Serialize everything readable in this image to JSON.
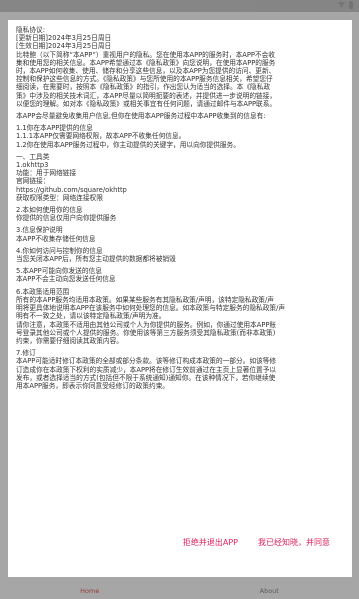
{
  "privacy": {
    "lines": [
      "隐私协议:",
      "[更新日期]2024年3月25日周日",
      "[生效日期]2024年3月25日周日",
      "  比特鲍（以下简称“本APP”）重视用户的隐私。您在使用本APP的服务时，本APP不会收",
      "集和使用您的相关信息。本APP希望通过本《隐私政策》向您说明，在使用本APP的服务",
      "时，本APP如何收集、使用、储存和分享这些信息，以及本APP为您提供的访问、更新、",
      "控制和保护这些信息的方式。《隐私政策》与您所使用的本APP服务信息相关，希望您仔",
      "细阅读，在需要时，按照本《隐私政策》的指引，作出您认为适当的选择。本《隐私政",
      "策》中涉及的相关技术词汇，本APP尽量以简明扼要的表述，并提供进一步说明的链接，",
      "以便您的理解。如对本《隐私政策》或相关事宜有任何问题，请通过邮件与本APP联系。",
      "",
      "本APP会尽量避免收集用户信息,但你在使用本APP服务过程中本APP收集到的信息有:",
      "",
      " 1.1你在本APP提供的信息",
      " 1.1.1本APP仅需要网络权限，故本APP不收集任何信息。",
      " 1.2你在使用本APP服务过程中，你主动提供的关键字，用以向你提供服务。",
      "",
      "一、工具类",
      "1.okhttp3",
      "功能：用于网络链接",
      "官网链接：",
      "https://github.com/square/okhttp",
      " 获取权限类型：网络连接权限",
      "",
      "2.本如何使用你的信息",
      "你提供的信息仅用户向你提供服务",
      "",
      "3.信息保护说明",
      "本APP不收集存储任何信息",
      "",
      "4.你如何访问与控制你的信息",
      "当您关闭本APP后，所有您主动提供的数据都将被销毁",
      "",
      "5.本APP可能向你发送的信息",
      "本APP不会主动向您发送任何信息",
      "",
      "6.本政策适用范围",
      "所有的本APP服务均适用本政策。如果某些服务有其隐私政策/声明，该特定隐私政策/声",
      "明将更具体地说明本APP在该服务中如何处理您的信息。如本政策与特定服务的隐私政策/声",
      "明有不一致之处，请以该特定隐私政策/声明为准。",
      " 请你注意，本政策不适用由其他公司或个人为你提供的服务。例如，你通过使用本APP账",
      "号登录其他公司或个人提供的服务。你使用该等第三方服务须受其隐私政策(而非本政策)",
      "约束，你需要仔细阅读其政策内容。",
      "",
      " 7.修订",
      "本APP可能适时修订本政策的全部或部分条款。该等修订构成本政策的一部分。如该等修",
      "订造成你在本政策下权利的实质减少，本APP将在修订生效前通过在主页上显著位置予以",
      "发布，或者选择适当的方式(包括但不限于系统通知)通知你。在该种情况下，若你继续使",
      "用本APP服务，即表示你同意受经修订的政策约束。"
    ]
  },
  "actions": {
    "reject_label": "拒绝并退出APP",
    "accept_label": "我已经知晓，并同意"
  },
  "bottom_nav": {
    "home_label": "Home",
    "about_label": "About"
  }
}
